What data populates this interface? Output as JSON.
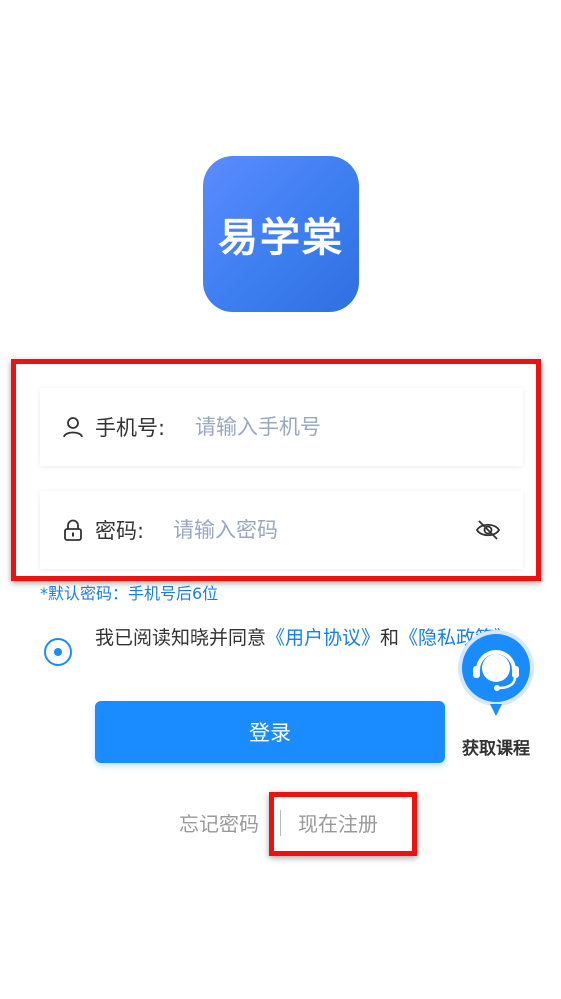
{
  "app": {
    "logo_text": "易学棠",
    "brand_color": "#1a8cff"
  },
  "form": {
    "phone_label": "手机号:",
    "phone_placeholder": "请输入手机号",
    "password_label": "密码:",
    "password_placeholder": "请输入密码",
    "default_password_hint": "*默认密码：手机号后6位"
  },
  "agreement": {
    "prefix": "我已阅读知晓并同意",
    "user_agreement": "《用户协议》",
    "and": "和",
    "privacy_policy": "《隐私政策》"
  },
  "actions": {
    "login": "登录",
    "forgot_password": "忘记密码",
    "register_now": "现在注册"
  },
  "float_widget": {
    "label": "获取课程"
  },
  "icons": {
    "user": "user-icon",
    "lock": "lock-icon",
    "eye_hidden": "eye-off-icon",
    "headset": "headset-icon"
  }
}
